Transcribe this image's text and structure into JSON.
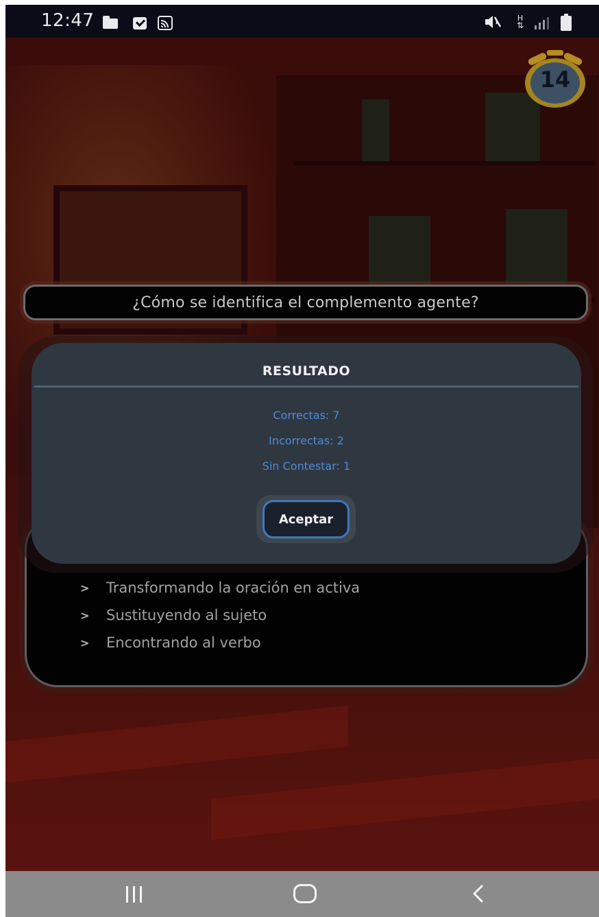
{
  "status_bar": {
    "time": "12:47",
    "data_indicator": "H",
    "icons": [
      "folder-icon",
      "check-icon",
      "cast-icon",
      "mute-icon",
      "data-icon",
      "signal-icon",
      "battery-icon"
    ]
  },
  "timer": {
    "value": "14"
  },
  "question": {
    "text": "¿Cómo se identifica el complemento agente?"
  },
  "answers": [
    {
      "text": "Transformando la oración en activa"
    },
    {
      "text": "Sustituyendo al sujeto"
    },
    {
      "text": "Encontrando al verbo"
    }
  ],
  "result_modal": {
    "title": "RESULTADO",
    "correct": "Correctas: 7",
    "incorrect": "Incorrectas: 2",
    "unanswered": "Sin Contestar: 1",
    "accept_label": "Aceptar"
  },
  "nav_bar": {
    "icons": [
      "recents-icon",
      "home-icon",
      "back-icon"
    ]
  },
  "colors": {
    "modal_bg": "#2f3741",
    "stat_text": "#4e8bd4",
    "accent_border": "#3e78c0",
    "timer_gold": "#a4851e"
  }
}
